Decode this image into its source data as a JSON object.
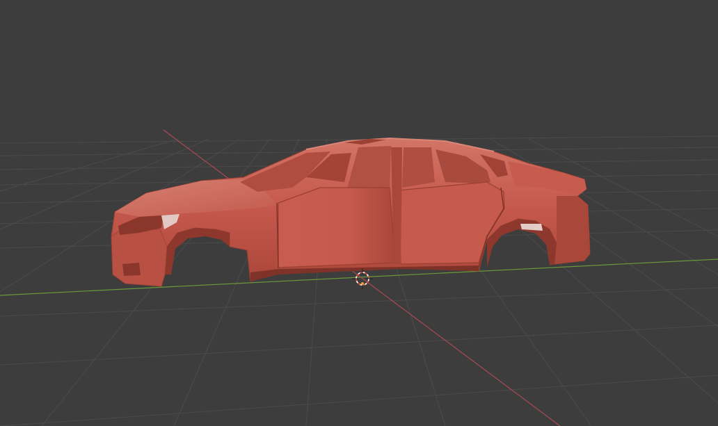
{
  "viewport": {
    "background": "#3d3d3d",
    "grid_color": "#4a4a4a",
    "x_axis_color": "#a84a55",
    "y_axis_color": "#6b9a3a"
  },
  "object": {
    "type": "car body shell",
    "material_color": "#c4574b",
    "shade_color": "#9e4136",
    "highlight_color": "#d9776a"
  },
  "cursor": {
    "icon": "3d-cursor-icon"
  }
}
